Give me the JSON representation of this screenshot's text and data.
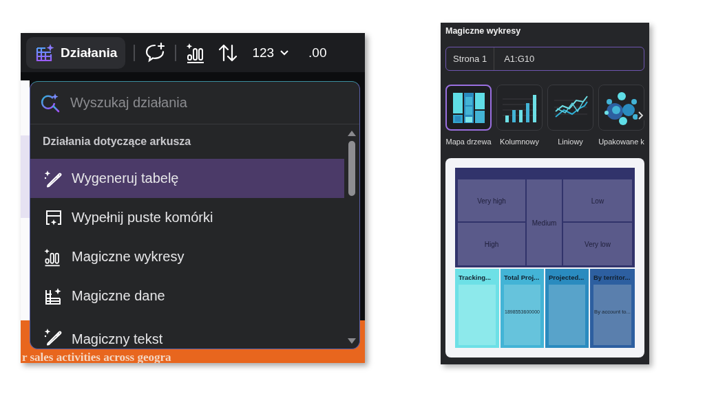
{
  "left_panel": {
    "toolbar": {
      "actions_button": "Działania",
      "number_format": "123",
      "decimal_format": ".00"
    },
    "sheet_banner": "r sales activities across geogra",
    "actions_menu": {
      "search": {
        "placeholder": "Wyszukaj działania"
      },
      "section_title": "Działania dotyczące arkusza",
      "items": [
        {
          "label": "Wygeneruj tabelę",
          "kind": "wand",
          "selected": true
        },
        {
          "label": "Wypełnij puste komórki",
          "kind": "fill",
          "selected": false
        },
        {
          "label": "Magiczne wykresy",
          "kind": "chart",
          "selected": false
        },
        {
          "label": "Magiczne dane",
          "kind": "data",
          "selected": false
        },
        {
          "label": "Magiczny tekst",
          "kind": "wand",
          "selected": false
        }
      ]
    }
  },
  "right_panel": {
    "title": "Magiczne wykresy",
    "range": {
      "sheet": "Strona 1",
      "cells": "A1:G10"
    },
    "chart_types": [
      {
        "label": "Mapa drzewa",
        "kind": "treemap",
        "selected": true
      },
      {
        "label": "Kolumnowy",
        "kind": "column",
        "selected": false
      },
      {
        "label": "Liniowy",
        "kind": "line",
        "selected": false
      },
      {
        "label": "Upakowane k",
        "kind": "bubble",
        "selected": false
      }
    ],
    "treemap": {
      "top_cells": [
        "Very high",
        "High",
        "Medium",
        "Low",
        "Very low"
      ],
      "bottom_groups": [
        {
          "title": "Tracking..."
        },
        {
          "title": "Total Proj...",
          "value": "1898553600000"
        },
        {
          "title": "Projected..."
        },
        {
          "title": "By territor...",
          "value": "By account to..."
        }
      ]
    }
  }
}
